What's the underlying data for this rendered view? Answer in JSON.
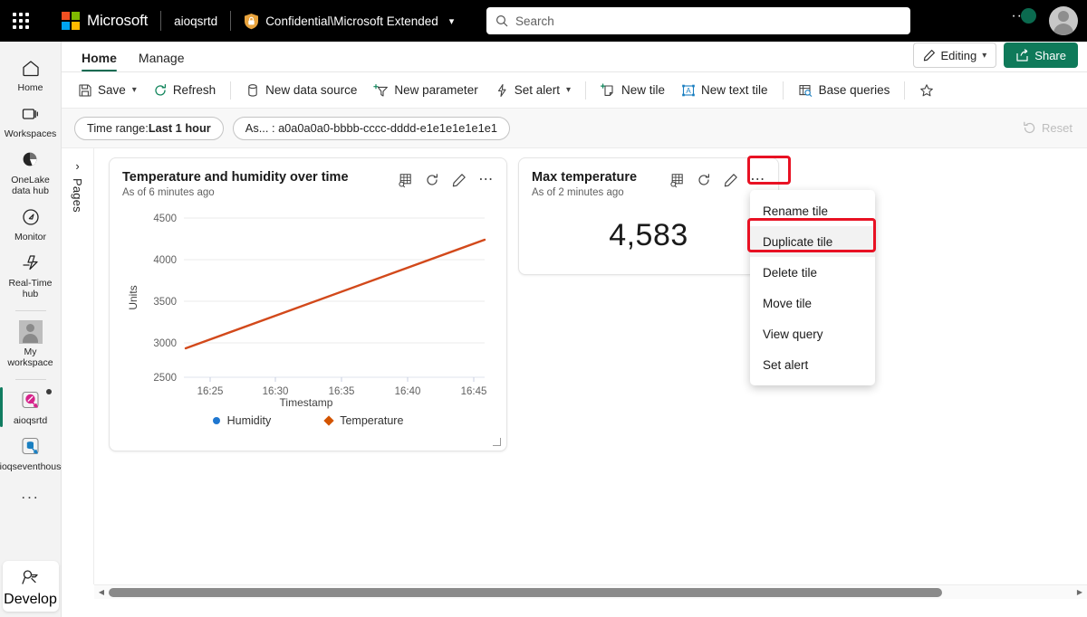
{
  "topbar": {
    "waffle_label": "app-launcher",
    "brand": "Microsoft",
    "tenant": "aioqsrtd",
    "sensitivity": "Confidential\\Microsoft Extended",
    "search_placeholder": "Search",
    "search_value": ""
  },
  "rail": {
    "items": [
      {
        "label": "Home",
        "icon": "home-icon"
      },
      {
        "label": "Workspaces",
        "icon": "workspaces-icon"
      },
      {
        "label": "OneLake data hub",
        "icon": "onelake-icon"
      },
      {
        "label": "Monitor",
        "icon": "monitor-icon"
      },
      {
        "label": "Real-Time hub",
        "icon": "real-time-hub-icon"
      },
      {
        "label": "My workspace",
        "icon": "my-workspace-thumb"
      },
      {
        "label": "aioqsrtd",
        "icon": "realtime-dashboard-icon"
      },
      {
        "label": "aioqseventhouse",
        "icon": "eventhouse-icon"
      }
    ],
    "more_label": "...",
    "develop_label": "Develop"
  },
  "tabs": [
    {
      "label": "Home",
      "active": true
    },
    {
      "label": "Manage",
      "active": false
    }
  ],
  "header_actions": {
    "editing_label": "Editing",
    "share_label": "Share"
  },
  "ribbon": [
    {
      "label": "Save",
      "icon": "save-icon",
      "chevron": true
    },
    {
      "label": "Refresh",
      "icon": "refresh-icon",
      "chevron": false
    },
    {
      "sep": true
    },
    {
      "label": "New data source",
      "icon": "database-icon",
      "chevron": false
    },
    {
      "label": "New parameter",
      "icon": "new-parameter-icon",
      "chevron": false
    },
    {
      "label": "Set alert",
      "icon": "alert-bolt-icon",
      "chevron": true
    },
    {
      "sep": true
    },
    {
      "label": "New tile",
      "icon": "new-tile-icon",
      "chevron": false
    },
    {
      "label": "New text tile",
      "icon": "new-text-tile-icon",
      "chevron": false
    },
    {
      "sep": true
    },
    {
      "label": "Base queries",
      "icon": "base-queries-icon",
      "chevron": false
    },
    {
      "sep": true
    },
    {
      "label": "Favorite",
      "icon": "star-icon",
      "chevron": false
    }
  ],
  "filterbar": {
    "time_range_prefix": "Time range: ",
    "time_range_value": "Last 1 hour",
    "param_pill": "As... : a0a0a0a0-bbbb-cccc-dddd-e1e1e1e1e1e1",
    "reset_label": "Reset"
  },
  "pages_panel": {
    "label": "Pages",
    "expand_icon": "chevron-right-icon"
  },
  "tiles": [
    {
      "title": "Temperature and humidity over time",
      "subtitle": "As of 6 minutes ago",
      "actions": [
        "explore-data-icon",
        "refresh-icon",
        "edit-pencil-icon",
        "more-options-icon"
      ]
    },
    {
      "title": "Max temperature",
      "subtitle": "As of 2 minutes ago",
      "value": "4,583",
      "actions": [
        "explore-data-icon",
        "refresh-icon",
        "edit-pencil-icon",
        "more-options-icon"
      ]
    }
  ],
  "context_menu": {
    "items": [
      {
        "label": "Rename tile",
        "highlighted": false
      },
      {
        "label": "Duplicate tile",
        "highlighted": true
      },
      {
        "label": "Delete tile",
        "highlighted": false
      },
      {
        "label": "Move tile",
        "highlighted": false
      },
      {
        "label": "View query",
        "highlighted": false
      },
      {
        "label": "Set alert",
        "highlighted": false
      }
    ]
  },
  "colors": {
    "brand_green": "#0f7a5a",
    "tab_underline": "#0f6b52",
    "temperature_line": "#d2491b",
    "humidity": "#1f77d0",
    "highlight_red": "#e81123",
    "topbar_bg": "#000000",
    "rail_bg": "#f3f3f3"
  },
  "chart_data": {
    "type": "line",
    "title": "Temperature and humidity over time",
    "xlabel": "Timestamp",
    "ylabel": "Units",
    "ylim": [
      2500,
      4500
    ],
    "yticks": [
      2500,
      3000,
      3500,
      4000,
      4500
    ],
    "xticks": [
      "16:25",
      "16:30",
      "16:35",
      "16:40",
      "16:45"
    ],
    "grid": true,
    "legend_position": "bottom",
    "series": [
      {
        "name": "Humidity",
        "color": "#1f77d0",
        "marker": "circle",
        "x": [],
        "values": []
      },
      {
        "name": "Temperature",
        "color": "#d2491b",
        "marker": "diamond",
        "x": [
          "16:24",
          "16:27",
          "16:30",
          "16:33",
          "16:36",
          "16:39",
          "16:42",
          "16:46"
        ],
        "values": [
          2850,
          3040,
          3230,
          3420,
          3610,
          3800,
          3990,
          4170
        ]
      }
    ]
  },
  "scrollbar": {
    "left_arrow": "scroll-left-arrow",
    "right_arrow": "scroll-right-arrow"
  }
}
